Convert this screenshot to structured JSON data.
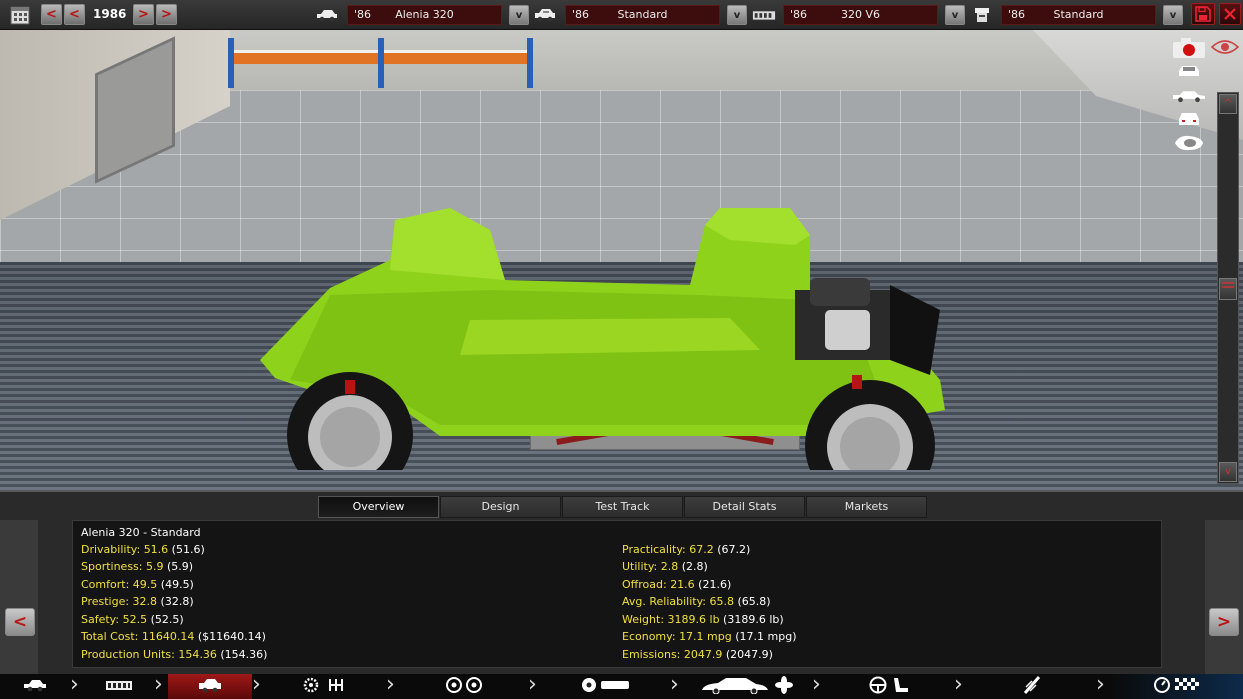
{
  "topbar": {
    "year": "1986",
    "prev_all_label": "<",
    "prev_label": "<",
    "next_label": ">",
    "next_all_label": ">",
    "dropdown_label": "v",
    "model": {
      "year": "'86",
      "name": "Alenia 320"
    },
    "trim": {
      "year": "'86",
      "name": "Standard"
    },
    "engine": {
      "year": "'86",
      "name": "320 V6"
    },
    "engine_trim": {
      "year": "'86",
      "name": "Standard"
    }
  },
  "viewport": {
    "scroll_up_label": "^",
    "scroll_down_label": "v",
    "view_icons": [
      "camera-icon",
      "eye-icon",
      "car-front-view-icon",
      "car-side-view-icon",
      "car-rear-view-icon",
      "car-top-view-icon"
    ]
  },
  "tabs": [
    {
      "label": "Overview",
      "active": true
    },
    {
      "label": "Design",
      "active": false
    },
    {
      "label": "Test Track",
      "active": false
    },
    {
      "label": "Detail Stats",
      "active": false
    },
    {
      "label": "Markets",
      "active": false
    }
  ],
  "overview": {
    "title": "Alenia 320 - Standard",
    "left": [
      {
        "label": "Drivability: ",
        "value": "51.6",
        "paren": " (51.6)"
      },
      {
        "label": "Sportiness: ",
        "value": "5.9",
        "paren": " (5.9)"
      },
      {
        "label": "Comfort: ",
        "value": "49.5",
        "paren": " (49.5)"
      },
      {
        "label": "Prestige: ",
        "value": "32.8",
        "paren": " (32.8)"
      },
      {
        "label": "Safety: ",
        "value": "52.5",
        "paren": " (52.5)"
      },
      {
        "label": "Total Cost: ",
        "value": "11640.14",
        "paren": " ($11640.14)"
      },
      {
        "label": "Production Units: ",
        "value": "154.36",
        "paren": " (154.36)"
      }
    ],
    "right": [
      {
        "label": "Practicality: ",
        "value": "67.2",
        "paren": " (67.2)"
      },
      {
        "label": "Utility: ",
        "value": "2.8",
        "paren": " (2.8)"
      },
      {
        "label": "Offroad: ",
        "value": "21.6",
        "paren": " (21.6)"
      },
      {
        "label": "Avg. Reliability: ",
        "value": "65.8",
        "paren": " (65.8)"
      },
      {
        "label": "Weight: ",
        "value": "3189.6 lb",
        "paren": " (3189.6 lb)"
      },
      {
        "label": "Economy: ",
        "value": "17.1 mpg",
        "paren": " (17.1 mpg)"
      },
      {
        "label": "Emissions: ",
        "value": "2047.9",
        "paren": " (2047.9)"
      }
    ]
  },
  "panel": {
    "prev_label": "<",
    "next_label": ">"
  },
  "bottomnav": [
    {
      "icon": "car-model-icon",
      "active": false
    },
    {
      "icon": "chassis-icon",
      "active": false
    },
    {
      "icon": "trim-icon",
      "active": true
    },
    {
      "icon": "engine-gearbox-icon",
      "active": false
    },
    {
      "icon": "wheels-icon",
      "active": false
    },
    {
      "icon": "brakes-icon",
      "active": false
    },
    {
      "icon": "body-aero-icon",
      "active": false
    },
    {
      "icon": "interior-icon",
      "active": false
    },
    {
      "icon": "suspension-icon",
      "active": false
    },
    {
      "icon": "test-finish-icon",
      "active": false
    }
  ],
  "colors": {
    "accent_red": "#b81414",
    "stat_yellow": "#f0e040",
    "chassis_green": "#8fd21c",
    "panel_bg": "#141414"
  }
}
